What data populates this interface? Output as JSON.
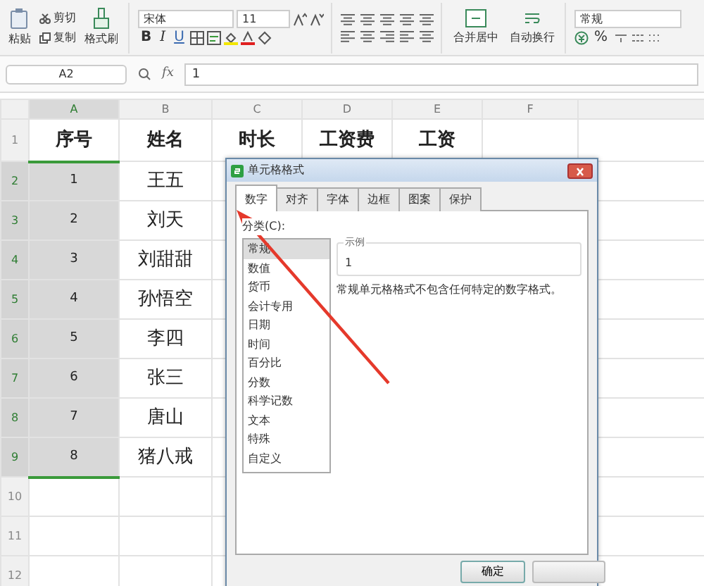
{
  "ribbon": {
    "clipboard": {
      "paste": "粘贴",
      "cut": "剪切",
      "copy": "复制",
      "format_painter": "格式刷"
    },
    "font": {
      "name": "宋体",
      "size": "11",
      "bold": "B",
      "italic": "I",
      "underline": "U"
    },
    "merge": "合并居中",
    "wrap": "自动换行",
    "number": {
      "format": "常规",
      "percent": "%"
    }
  },
  "formula_bar": {
    "cell": "A2",
    "fx": "fx",
    "value": "1"
  },
  "sheet": {
    "columns": [
      {
        "label": "A",
        "selected": true
      },
      {
        "label": "B",
        "selected": false
      },
      {
        "label": "C",
        "selected": false
      },
      {
        "label": "D",
        "selected": false
      },
      {
        "label": "E",
        "selected": false
      },
      {
        "label": "F",
        "selected": false
      }
    ],
    "rows": [
      {
        "number": "1",
        "kind": "header",
        "selected": false,
        "cells": [
          "序号",
          "姓名",
          "时长",
          "工资费",
          "工资"
        ]
      },
      {
        "number": "2",
        "kind": "data",
        "selected": true,
        "cells": [
          "1",
          "王五"
        ]
      },
      {
        "number": "3",
        "kind": "data",
        "selected": true,
        "cells": [
          "2",
          "刘天"
        ]
      },
      {
        "number": "4",
        "kind": "data",
        "selected": true,
        "cells": [
          "3",
          "刘甜甜"
        ]
      },
      {
        "number": "5",
        "kind": "data",
        "selected": true,
        "cells": [
          "4",
          "孙悟空"
        ]
      },
      {
        "number": "6",
        "kind": "data",
        "selected": true,
        "cells": [
          "5",
          "李四"
        ]
      },
      {
        "number": "7",
        "kind": "data",
        "selected": true,
        "cells": [
          "6",
          "张三"
        ]
      },
      {
        "number": "8",
        "kind": "data",
        "selected": true,
        "cells": [
          "7",
          "唐山"
        ]
      },
      {
        "number": "9",
        "kind": "data",
        "selected": true,
        "cells": [
          "8",
          "猪八戒"
        ]
      },
      {
        "number": "10",
        "kind": "empty",
        "selected": false
      },
      {
        "number": "11",
        "kind": "empty",
        "selected": false
      },
      {
        "number": "12",
        "kind": "empty",
        "selected": false
      }
    ]
  },
  "dialog": {
    "title": "单元格格式",
    "tabs": [
      {
        "label": "数字",
        "selected": true
      },
      {
        "label": "对齐",
        "selected": false
      },
      {
        "label": "字体",
        "selected": false
      },
      {
        "label": "边框",
        "selected": false
      },
      {
        "label": "图案",
        "selected": false
      },
      {
        "label": "保护",
        "selected": false
      }
    ],
    "category_label": "分类(C):",
    "categories": [
      {
        "label": "常规",
        "selected": true
      },
      {
        "label": "数值",
        "selected": false
      },
      {
        "label": "货币",
        "selected": false
      },
      {
        "label": "会计专用",
        "selected": false
      },
      {
        "label": "日期",
        "selected": false
      },
      {
        "label": "时间",
        "selected": false
      },
      {
        "label": "百分比",
        "selected": false
      },
      {
        "label": "分数",
        "selected": false
      },
      {
        "label": "科学记数",
        "selected": false
      },
      {
        "label": "文本",
        "selected": false
      },
      {
        "label": "特殊",
        "selected": false
      },
      {
        "label": "自定义",
        "selected": false
      }
    ],
    "sample_label": "示例",
    "sample_value": "1",
    "description": "常规单元格格式不包含任何特定的数字格式。",
    "buttons": [
      {
        "kind": "labeled",
        "label": "确定"
      },
      {
        "kind": "covered"
      }
    ]
  }
}
